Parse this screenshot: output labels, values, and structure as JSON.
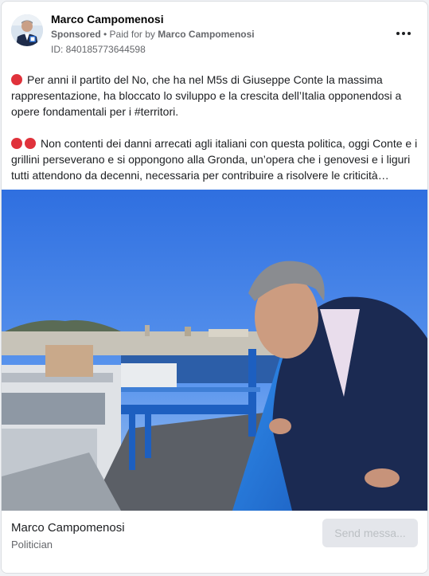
{
  "ad": {
    "page_name": "Marco Campomenosi",
    "sponsored_label": "Sponsored",
    "separator": " • ",
    "paid_for_prefix": "Paid for by ",
    "paid_for_name": "Marco Campomenosi",
    "ad_id": "ID: 840185773644598",
    "more_icon": "ellipsis-icon",
    "body": {
      "paragraph_1": "Per anni il partito del No, che ha nel M5s di Giuseppe Conte la massima rappresentazione, ha bloccato lo sviluppo e la crescita dell’Italia opponendosi a opere fondamentali per i #territori.",
      "paragraph_2": "Non contenti dei danni arrecati agli italiani con questa politica, oggi Conte e i grillini perseverano e si oppongono alla Gronda, un’opera che i genovesi e i liguri tutti attendono da decenni, necessaria per contribuire a risolvere le criticità…"
    },
    "emoji_color": "#e0323b",
    "footer": {
      "name": "Marco Campomenosi",
      "category": "Politician",
      "cta_label": "Send messa..."
    }
  }
}
